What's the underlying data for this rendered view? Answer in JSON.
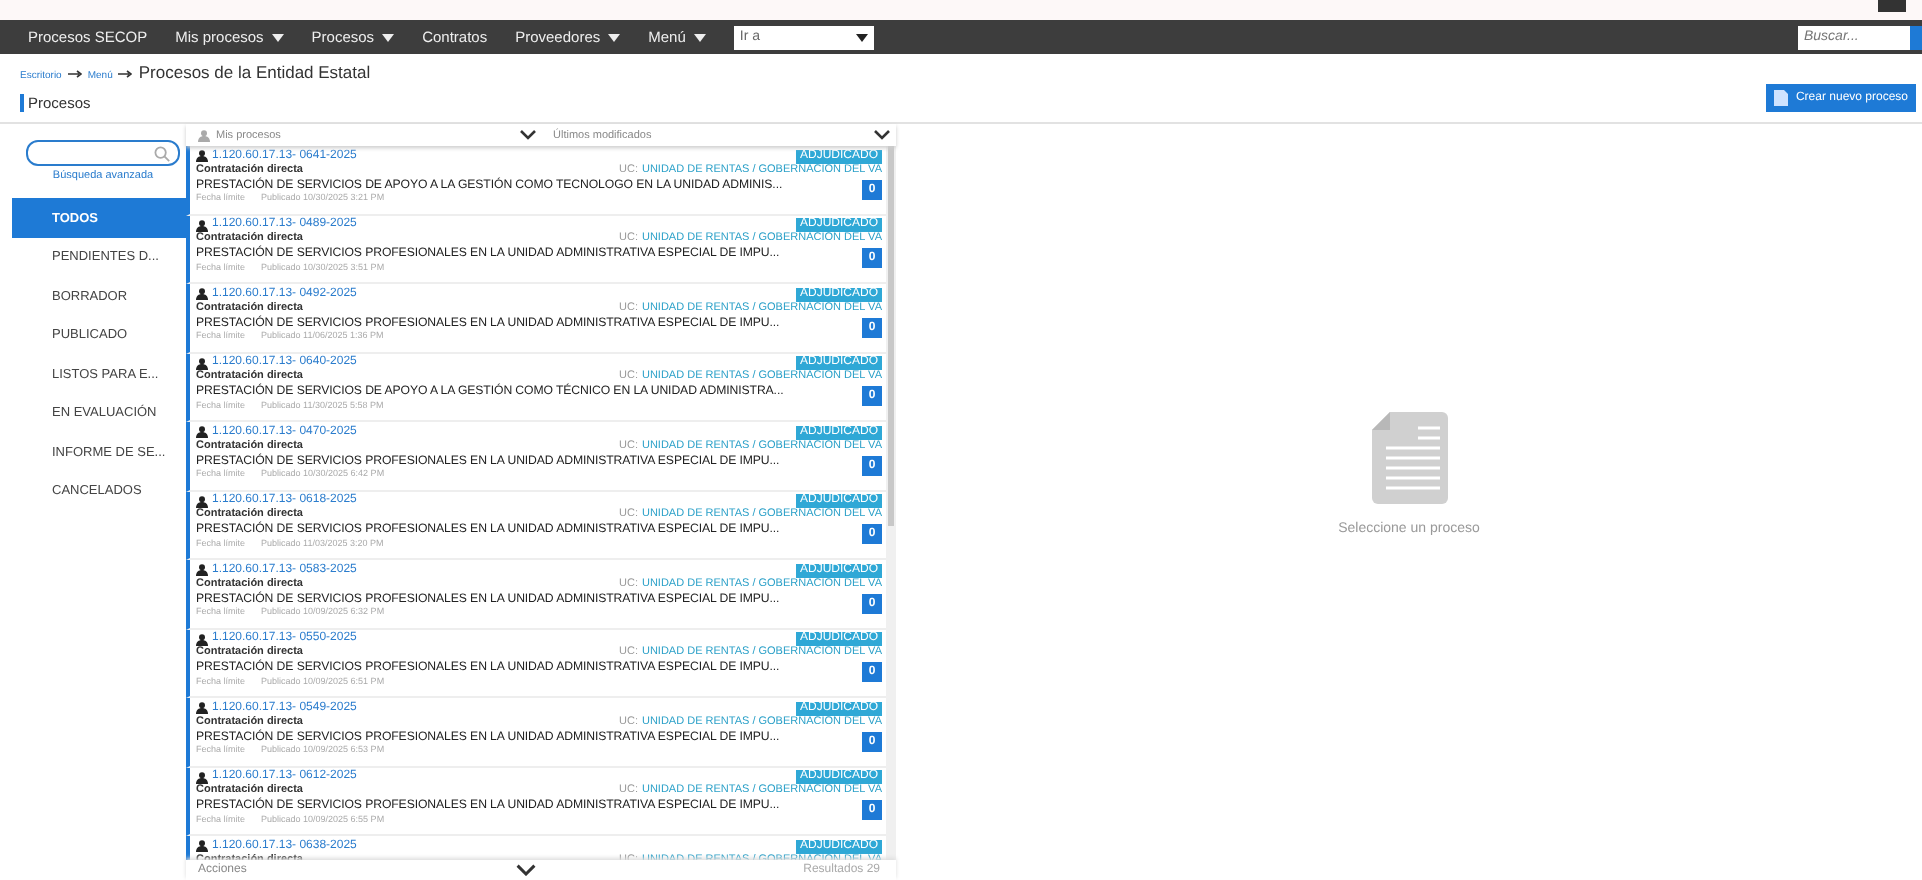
{
  "nav": {
    "items": [
      {
        "label": "Procesos SECOP",
        "dropdown": false
      },
      {
        "label": "Mis procesos",
        "dropdown": true
      },
      {
        "label": "Procesos",
        "dropdown": true
      },
      {
        "label": "Contratos",
        "dropdown": false
      },
      {
        "label": "Proveedores",
        "dropdown": true
      },
      {
        "label": "Menú",
        "dropdown": true
      }
    ],
    "goto": {
      "value": "Ir a"
    },
    "search": {
      "placeholder": "Buscar..."
    }
  },
  "breadcrumb": {
    "links": [
      "Escritorio",
      "Menú"
    ],
    "title": "Procesos de la Entidad Estatal"
  },
  "section_title": "Procesos",
  "create_button": "Crear nuevo proceso",
  "sidebar": {
    "advanced_search": "Búsqueda avanzada",
    "items": [
      {
        "label": "TODOS",
        "selected": true
      },
      {
        "label": "PENDIENTES D...",
        "selected": false
      },
      {
        "label": "BORRADOR",
        "selected": false
      },
      {
        "label": "PUBLICADO",
        "selected": false
      },
      {
        "label": "LISTOS PARA E...",
        "selected": false
      },
      {
        "label": "EN EVALUACIÓN",
        "selected": false
      },
      {
        "label": "INFORME DE SE...",
        "selected": false
      },
      {
        "label": "CANCELADOS",
        "selected": false
      }
    ]
  },
  "list": {
    "filter": "Mis procesos",
    "sort": "Últimos modificados",
    "rows": [
      {
        "id": "1.120.60.17.13- 0641-2025",
        "type": "Contratación directa",
        "uc_label": "UC:",
        "unit": "UNIDAD DE RENTAS / GOBERNACION DEL VA",
        "status": "ADJUDICADO",
        "title": "PRESTACIÓN DE SERVICIOS DE APOYO A LA GESTIÓN COMO TECNOLOGO EN LA UNIDAD ADMINIS...",
        "deadline": "Fecha límite",
        "published": "Publicado 10/30/2025 3:21 PM",
        "count": "0"
      },
      {
        "id": "1.120.60.17.13- 0489-2025",
        "type": "Contratación directa",
        "uc_label": "UC:",
        "unit": "UNIDAD DE RENTAS / GOBERNACION DEL VA",
        "status": "ADJUDICADO",
        "title": "PRESTACIÓN DE SERVICIOS PROFESIONALES EN LA UNIDAD ADMINISTRATIVA ESPECIAL DE IMPU...",
        "deadline": "Fecha límite",
        "published": "Publicado 10/30/2025 3:51 PM",
        "count": "0"
      },
      {
        "id": "1.120.60.17.13- 0492-2025",
        "type": "Contratación directa",
        "uc_label": "UC:",
        "unit": "UNIDAD DE RENTAS / GOBERNACION DEL VA",
        "status": "ADJUDICADO",
        "title": "PRESTACIÓN DE SERVICIOS PROFESIONALES EN LA UNIDAD ADMINISTRATIVA ESPECIAL DE IMPU...",
        "deadline": "Fecha límite",
        "published": "Publicado 11/06/2025 1:36 PM",
        "count": "0"
      },
      {
        "id": "1.120.60.17.13- 0640-2025",
        "type": "Contratación directa",
        "uc_label": "UC:",
        "unit": "UNIDAD DE RENTAS / GOBERNACION DEL VA",
        "status": "ADJUDICADO",
        "title": "PRESTACIÓN DE SERVICIOS DE APOYO A LA GESTIÓN COMO TÉCNICO EN LA UNIDAD ADMINISTRA...",
        "deadline": "Fecha límite",
        "published": "Publicado 11/30/2025 5:58 PM",
        "count": "0"
      },
      {
        "id": "1.120.60.17.13- 0470-2025",
        "type": "Contratación directa",
        "uc_label": "UC:",
        "unit": "UNIDAD DE RENTAS / GOBERNACION DEL VA",
        "status": "ADJUDICADO",
        "title": "PRESTACIÓN DE SERVICIOS PROFESIONALES EN LA UNIDAD ADMINISTRATIVA ESPECIAL DE IMPU...",
        "deadline": "Fecha límite",
        "published": "Publicado 10/30/2025 6:42 PM",
        "count": "0"
      },
      {
        "id": "1.120.60.17.13- 0618-2025",
        "type": "Contratación directa",
        "uc_label": "UC:",
        "unit": "UNIDAD DE RENTAS / GOBERNACION DEL VA",
        "status": "ADJUDICADO",
        "title": "PRESTACIÓN DE SERVICIOS PROFESIONALES EN LA UNIDAD ADMINISTRATIVA ESPECIAL DE IMPU...",
        "deadline": "Fecha límite",
        "published": "Publicado 11/03/2025 3:20 PM",
        "count": "0"
      },
      {
        "id": "1.120.60.17.13- 0583-2025",
        "type": "Contratación directa",
        "uc_label": "UC:",
        "unit": "UNIDAD DE RENTAS / GOBERNACION DEL VA",
        "status": "ADJUDICADO",
        "title": "PRESTACIÓN DE SERVICIOS PROFESIONALES EN LA UNIDAD ADMINISTRATIVA ESPECIAL DE IMPU...",
        "deadline": "Fecha límite",
        "published": "Publicado 10/09/2025 6:32 PM",
        "count": "0"
      },
      {
        "id": "1.120.60.17.13- 0550-2025",
        "type": "Contratación directa",
        "uc_label": "UC:",
        "unit": "UNIDAD DE RENTAS / GOBERNACION DEL VA",
        "status": "ADJUDICADO",
        "title": "PRESTACIÓN DE SERVICIOS PROFESIONALES EN LA UNIDAD ADMINISTRATIVA ESPECIAL DE IMPU...",
        "deadline": "Fecha límite",
        "published": "Publicado 10/09/2025 6:51 PM",
        "count": "0"
      },
      {
        "id": "1.120.60.17.13- 0549-2025",
        "type": "Contratación directa",
        "uc_label": "UC:",
        "unit": "UNIDAD DE RENTAS / GOBERNACION DEL VA",
        "status": "ADJUDICADO",
        "title": "PRESTACIÓN DE SERVICIOS PROFESIONALES EN LA UNIDAD ADMINISTRATIVA ESPECIAL DE IMPU...",
        "deadline": "Fecha límite",
        "published": "Publicado 10/09/2025 6:53 PM",
        "count": "0"
      },
      {
        "id": "1.120.60.17.13- 0612-2025",
        "type": "Contratación directa",
        "uc_label": "UC:",
        "unit": "UNIDAD DE RENTAS / GOBERNACION DEL VA",
        "status": "ADJUDICADO",
        "title": "PRESTACIÓN DE SERVICIOS PROFESIONALES EN LA UNIDAD ADMINISTRATIVA ESPECIAL DE IMPU...",
        "deadline": "Fecha límite",
        "published": "Publicado 10/09/2025 6:55 PM",
        "count": "0"
      },
      {
        "id": "1.120.60.17.13- 0638-2025",
        "type": "Contratación directa",
        "uc_label": "UC:",
        "unit": "UNIDAD DE RENTAS / GOBERNACION DEL VA",
        "status": "ADJUDICADO"
      }
    ],
    "actions": "Acciones",
    "results": "Resultados  29"
  },
  "detail": {
    "empty_text": "Seleccione un proceso"
  }
}
